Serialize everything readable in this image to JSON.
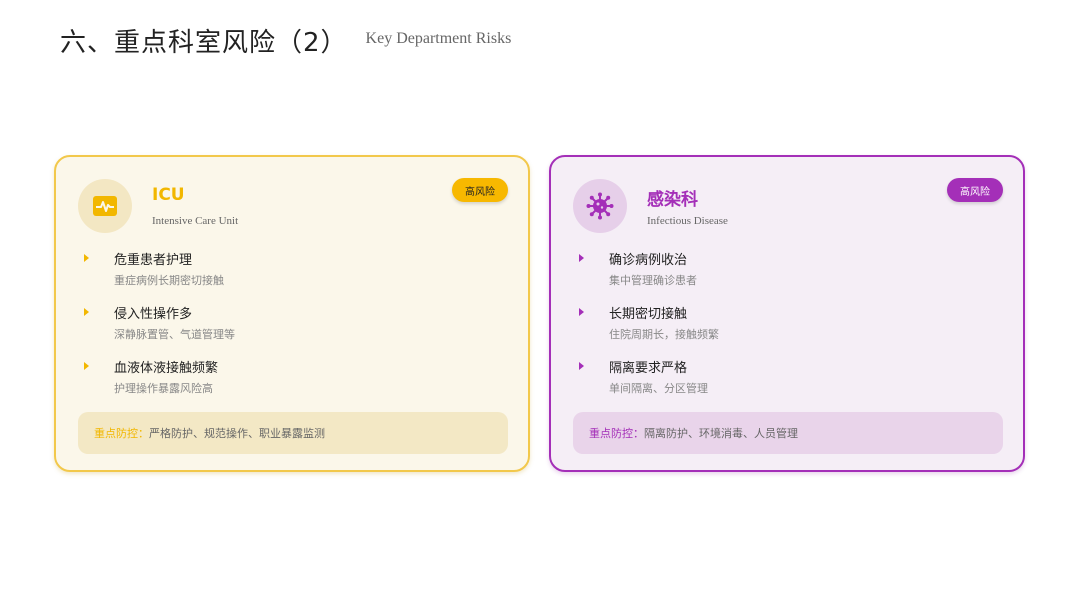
{
  "header": {
    "title": "六、重点科室风险（2）",
    "subtitle": "Key Department Risks"
  },
  "cards": [
    {
      "name": "ICU",
      "name_en": "Intensive Care Unit",
      "badge": "高风险",
      "icon": "heart-monitor-icon",
      "accent_color": "#f2b700",
      "items": [
        {
          "title": "危重患者护理",
          "desc": "重症病例长期密切接触"
        },
        {
          "title": "侵入性操作多",
          "desc": "深静脉置管、气道管理等"
        },
        {
          "title": "血液体液接触频繁",
          "desc": "护理操作暴露风险高"
        }
      ],
      "prevention_label": "重点防控：",
      "prevention_text": "严格防护、规范操作、职业暴露监测"
    },
    {
      "name": "感染科",
      "name_en": "Infectious Disease",
      "badge": "高风险",
      "icon": "virus-icon",
      "accent_color": "#a42fb8",
      "items": [
        {
          "title": "确诊病例收治",
          "desc": "集中管理确诊患者"
        },
        {
          "title": "长期密切接触",
          "desc": "住院周期长，接触频繁"
        },
        {
          "title": "隔离要求严格",
          "desc": "单间隔离、分区管理"
        }
      ],
      "prevention_label": "重点防控：",
      "prevention_text": "隔离防护、环境消毒、人员管理"
    }
  ]
}
